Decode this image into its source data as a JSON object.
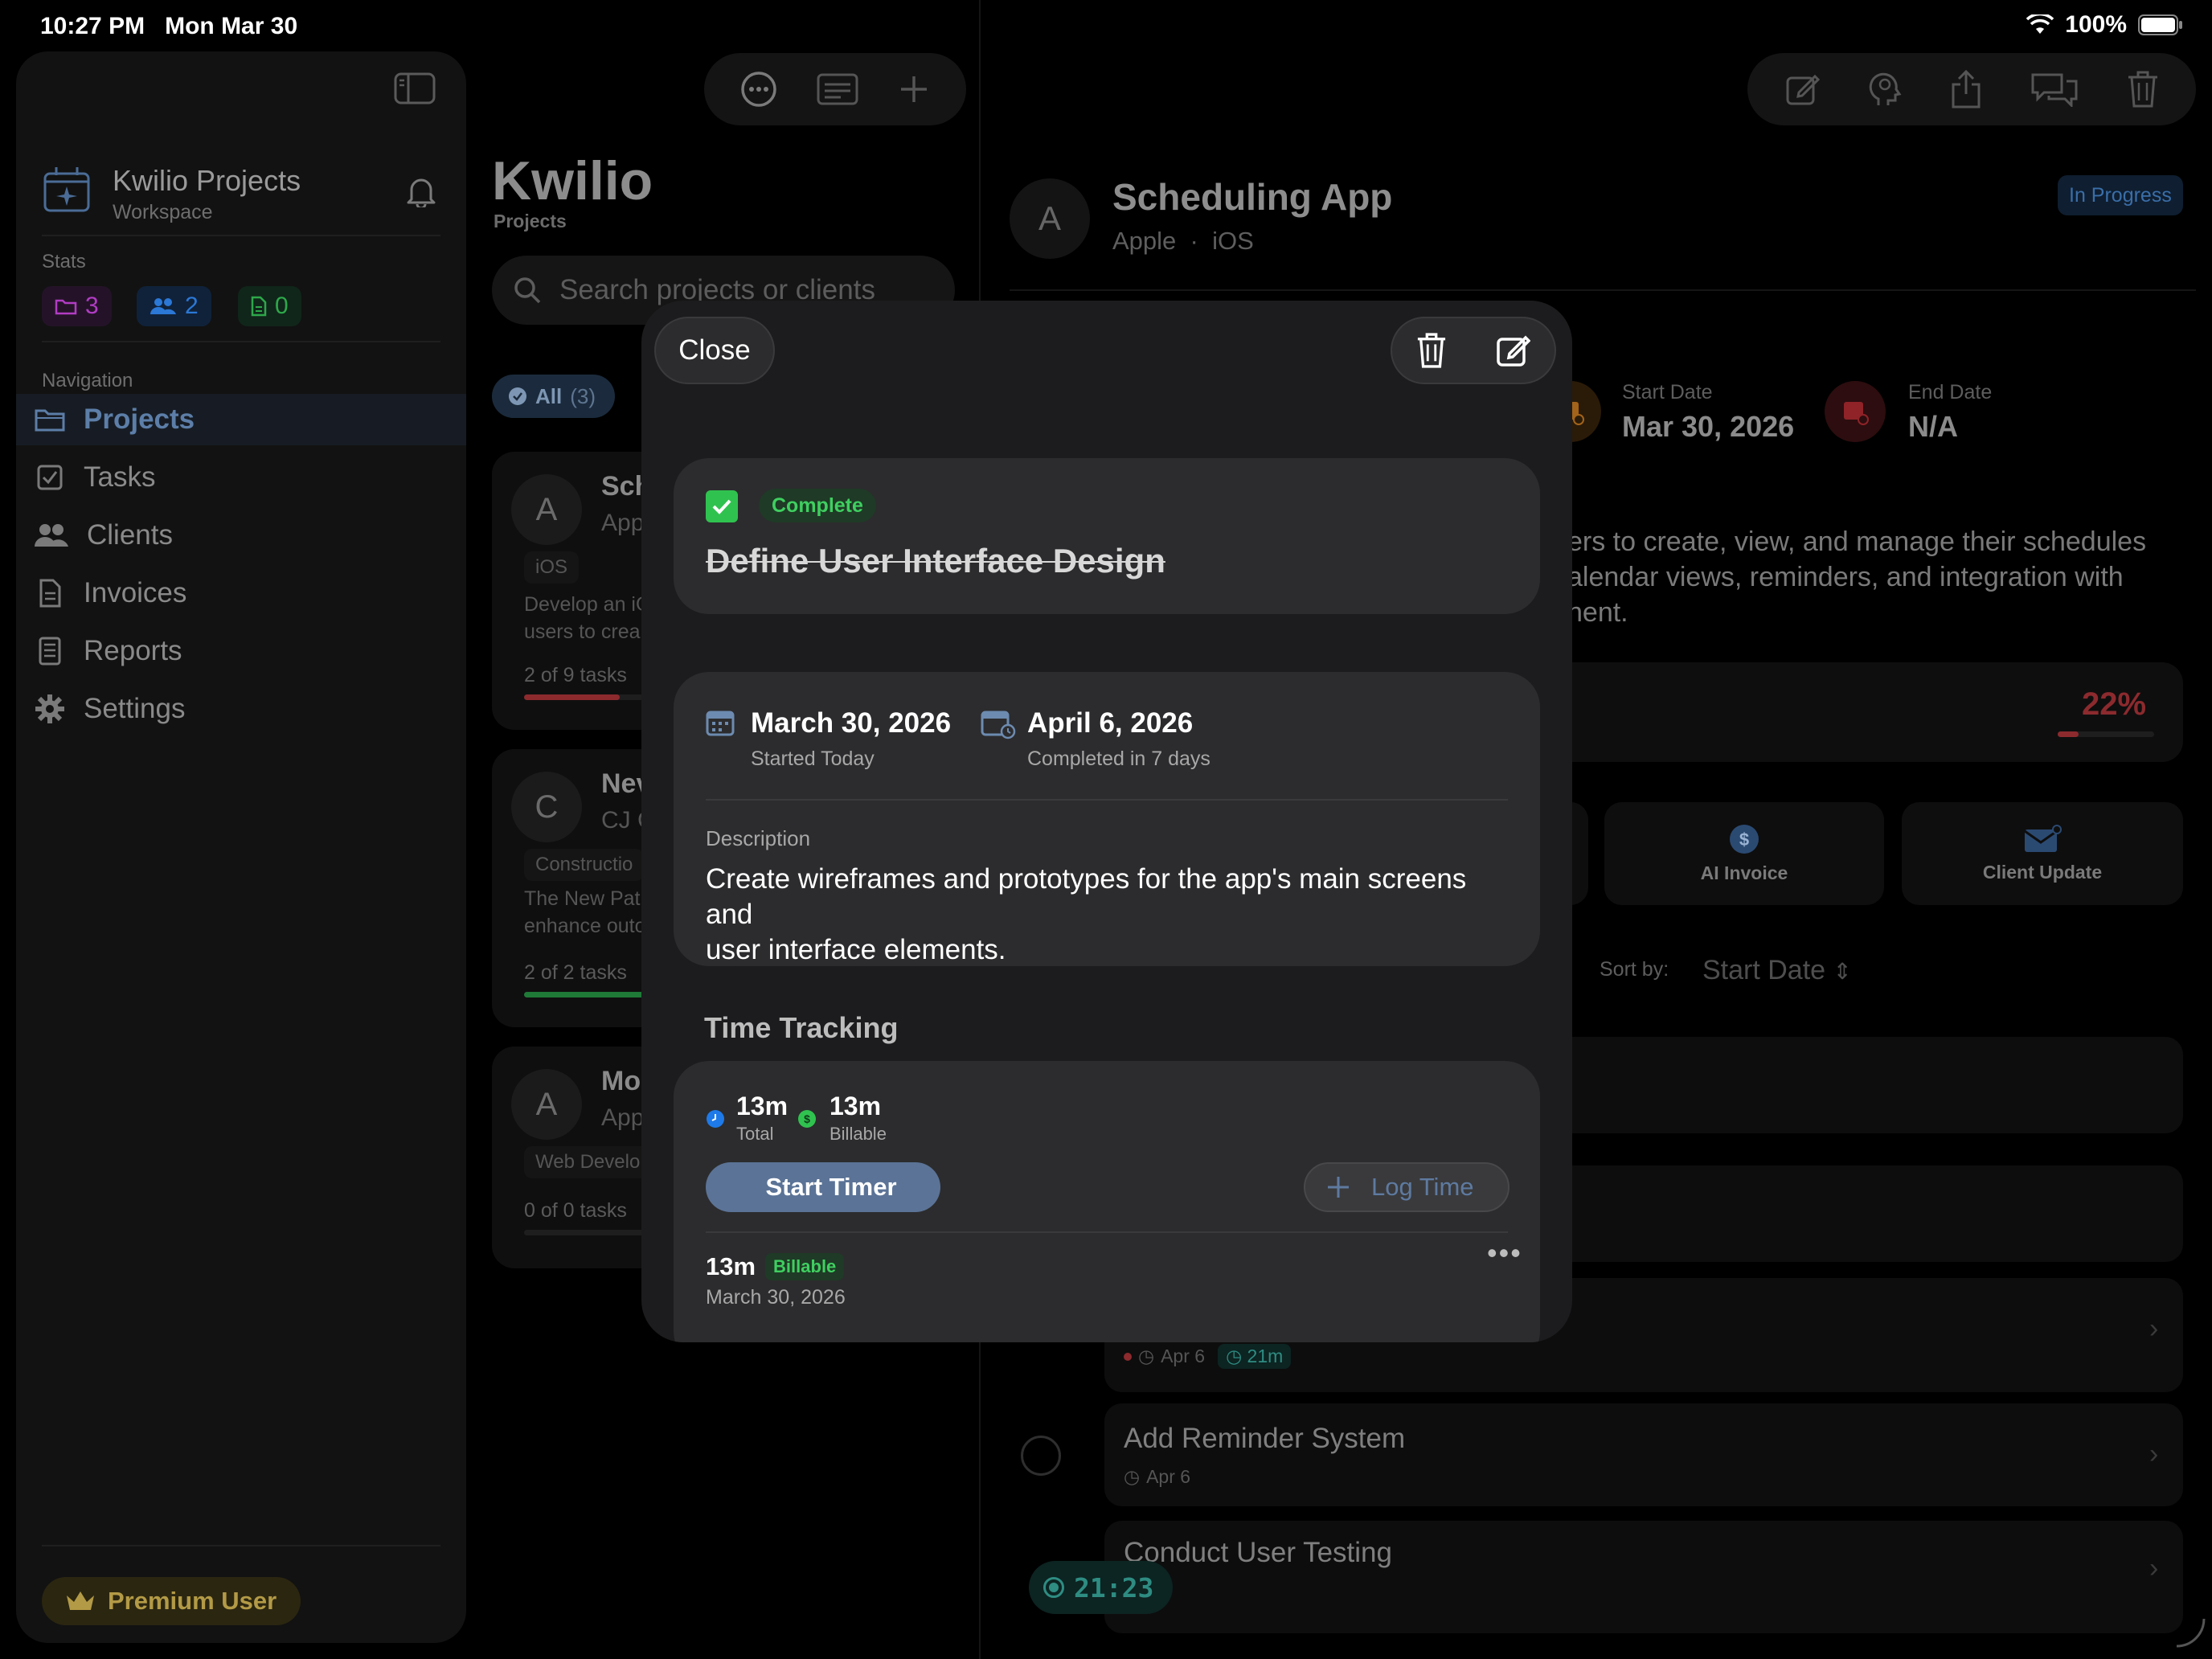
{
  "status_bar": {
    "time": "10:27 PM",
    "date": "Mon Mar 30",
    "battery": "100%"
  },
  "sidebar": {
    "workspace_title": "Kwilio Projects",
    "workspace_sub": "Workspace",
    "stats_label": "Stats",
    "stats": [
      {
        "icon": "folder-icon",
        "value": "3",
        "color": "#b13cc4"
      },
      {
        "icon": "people-icon",
        "value": "2",
        "color": "#2b78d6"
      },
      {
        "icon": "document-icon",
        "value": "0",
        "color": "#2ea84a"
      }
    ],
    "nav_label": "Navigation",
    "nav_items": [
      {
        "label": "Projects",
        "icon": "folder-icon"
      },
      {
        "label": "Tasks",
        "icon": "checkbox-icon"
      },
      {
        "label": "Clients",
        "icon": "people-icon"
      },
      {
        "label": "Invoices",
        "icon": "document-icon"
      },
      {
        "label": "Reports",
        "icon": "report-icon"
      },
      {
        "label": "Settings",
        "icon": "gear-icon"
      }
    ],
    "premium_label": "Premium User"
  },
  "middle": {
    "title": "Kwilio",
    "subtitle": "Projects",
    "search_placeholder": "Search projects or clients",
    "filter_label": "All",
    "filter_count": "(3)",
    "projects": [
      {
        "avatar": "A",
        "name": "Sch",
        "client": "App",
        "tag": "iOS",
        "desc1": "Develop an iO",
        "desc2": "users to crea",
        "count": "2 of 9 tasks",
        "progress": 0.22,
        "bar_color": "#8c2a2e"
      },
      {
        "avatar": "C",
        "name": "Nev",
        "client": "CJ C",
        "tag": "Constructio",
        "desc1": "The New Pat",
        "desc2": "enhance outo",
        "count": "2 of 2 tasks",
        "progress": 1.0,
        "bar_color": "#1f7a37"
      },
      {
        "avatar": "A",
        "name": "Mo",
        "client": "App",
        "tag": "Web Develo",
        "desc1": "",
        "desc2": "",
        "count": "0 of 0 tasks",
        "progress": 0,
        "bar_color": "#333"
      }
    ]
  },
  "right": {
    "project_avatar": "A",
    "project_title": "Scheduling App",
    "project_client": "Apple",
    "project_platform": "iOS",
    "status_badge": "In Progress",
    "start_label": "Start Date",
    "start_value": "Mar 30, 2026",
    "end_label": "End Date",
    "end_value": "N/A",
    "desc_line1": "ers to create, view, and manage their schedules",
    "desc_line2": "alendar views, reminders, and integration with",
    "desc_line3": "nent.",
    "progress_pct": "22%",
    "progress": 0.22,
    "actions": [
      {
        "label": "AI Invoice",
        "icon": "dollar-icon"
      },
      {
        "label": "Client Update",
        "icon": "mail-icon"
      }
    ],
    "sort_label": "Sort by:",
    "sort_value": "Start Date",
    "tasks": [
      {
        "name": "",
        "meta_date": "Apr 6",
        "meta_time": "21m"
      },
      {
        "name": "Add Reminder System",
        "meta_date": "Apr 6"
      },
      {
        "name": "Conduct User Testing",
        "meta_date": "6"
      }
    ],
    "running_timer": "21:23"
  },
  "modal": {
    "close_label": "Close",
    "status_label": "Complete",
    "task_title": "Define User Interface Design",
    "start_date": "March 30, 2026",
    "start_sub": "Started Today",
    "end_date": "April 6, 2026",
    "end_sub": "Completed in 7 days",
    "description_label": "Description",
    "description_line1": "Create wireframes and prototypes for the app's main screens and",
    "description_line2": "user interface elements.",
    "time_tracking_heading": "Time Tracking",
    "total_value": "13m",
    "total_label": "Total",
    "billable_value": "13m",
    "billable_label": "Billable",
    "start_timer_label": "Start Timer",
    "log_time_label": "Log Time",
    "entries": [
      {
        "duration": "13m",
        "badge": "Billable",
        "date": "March 30, 2026"
      }
    ]
  }
}
